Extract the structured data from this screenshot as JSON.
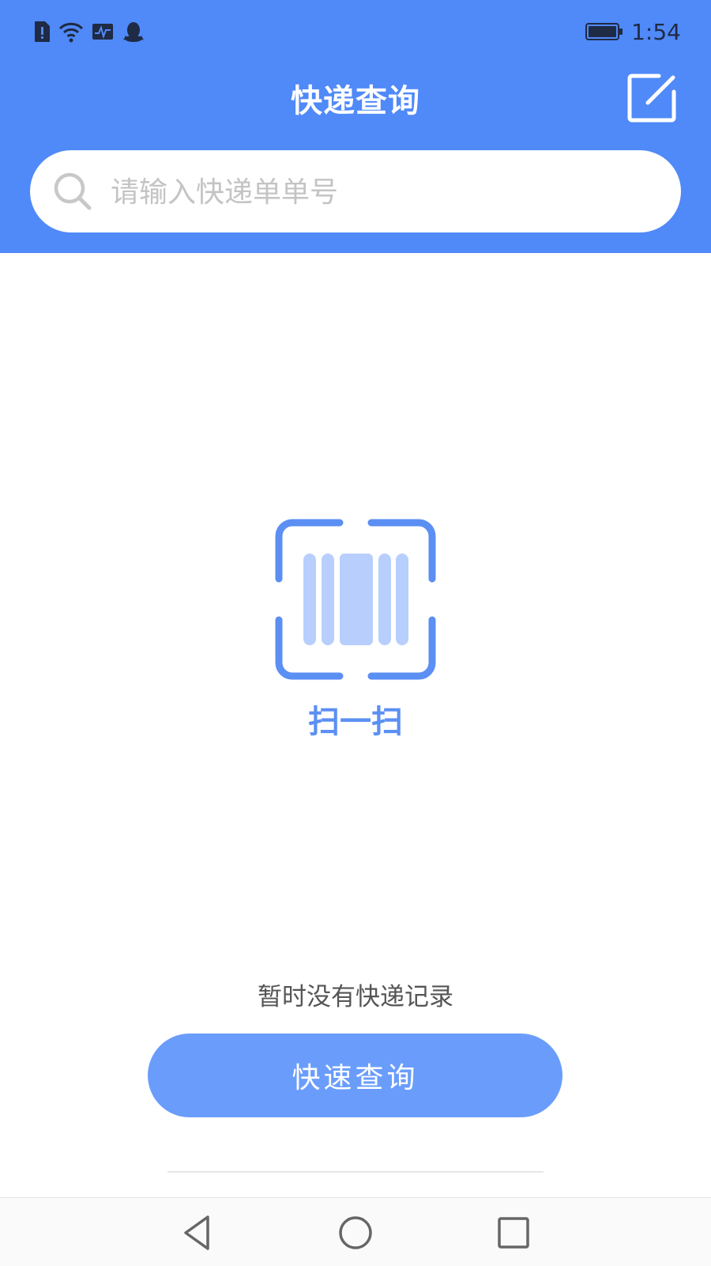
{
  "status_bar": {
    "time": "1:54",
    "icons": [
      "sim-alert-icon",
      "wifi-icon",
      "activity-monitor-icon",
      "qq-penguin-icon",
      "battery-icon"
    ]
  },
  "header": {
    "title": "快递查询",
    "edit_icon": "edit-icon",
    "background": "#5089f8"
  },
  "search": {
    "placeholder": "请输入快递单单号",
    "value": "",
    "icon": "search-icon"
  },
  "scan": {
    "label": "扫一扫",
    "icon": "barcode-scan-icon",
    "color": "#5b8ff3"
  },
  "empty_state": {
    "text": "暂时没有快递记录"
  },
  "query_button": {
    "label": "快速查询",
    "color": "#6a9dfb"
  },
  "nav_bar": {
    "buttons": [
      "back-triangle-icon",
      "home-circle-icon",
      "recents-square-icon"
    ]
  }
}
